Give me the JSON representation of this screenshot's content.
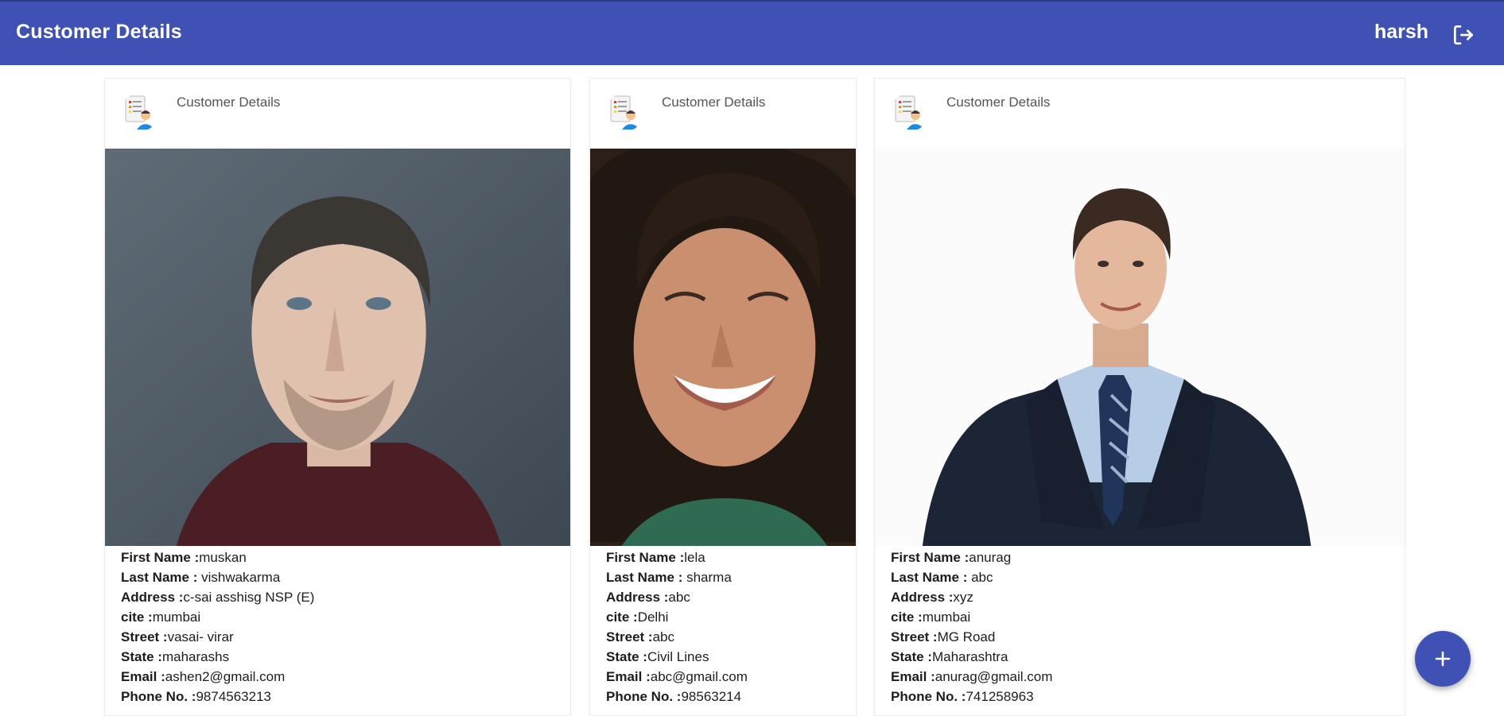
{
  "header": {
    "title": "Customer Details",
    "username": "harsh",
    "logout_icon": "logout-icon"
  },
  "customers": [
    {
      "card_title": "Customer Details",
      "first_name_label": "First Name :",
      "first_name": "muskan",
      "last_name_label": "Last Name :",
      "last_name": " vishwakarma",
      "address_label": "Address :",
      "address": "c-sai asshisg NSP (E)",
      "city_label": "cite :",
      "city": "mumbai",
      "street_label": "Street :",
      "street": "vasai- virar",
      "state_label": "State :",
      "state": "maharashs",
      "email_label": "Email :",
      "email": "ashen2@gmail.com",
      "phone_label": "Phone No. :",
      "phone": "9874563213"
    },
    {
      "card_title": "Customer Details",
      "first_name_label": "First Name :",
      "first_name": "lela",
      "last_name_label": "Last Name :",
      "last_name": " sharma",
      "address_label": "Address :",
      "address": "abc",
      "city_label": "cite :",
      "city": "Delhi",
      "street_label": "Street :",
      "street": "abc",
      "state_label": "State :",
      "state": "Civil Lines",
      "email_label": "Email :",
      "email": "abc@gmail.com",
      "phone_label": "Phone No. :",
      "phone": "98563214"
    },
    {
      "card_title": "Customer Details",
      "first_name_label": "First Name :",
      "first_name": "anurag",
      "last_name_label": "Last Name :",
      "last_name": " abc",
      "address_label": "Address :",
      "address": "xyz",
      "city_label": "cite :",
      "city": "mumbai",
      "street_label": "Street :",
      "street": "MG Road",
      "state_label": "State :",
      "state": "Maharashtra",
      "email_label": "Email :",
      "email": "anurag@gmail.com",
      "phone_label": "Phone No. :",
      "phone": "741258963"
    }
  ],
  "fab": {
    "icon": "plus-icon"
  },
  "colors": {
    "primary": "#3f51b5",
    "header_text": "#ffffff"
  }
}
